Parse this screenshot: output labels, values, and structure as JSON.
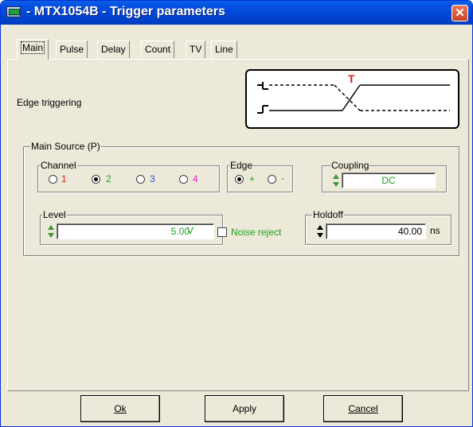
{
  "window": {
    "title": " - MTX1054B - Trigger parameters",
    "close_label": "✕"
  },
  "tabs": [
    {
      "label": "Main",
      "active": true
    },
    {
      "label": "Pulse"
    },
    {
      "label": "Delay"
    },
    {
      "label": "Count"
    },
    {
      "label": "TV"
    },
    {
      "label": "Line"
    }
  ],
  "main": {
    "mode_label": "Edge triggering",
    "diagram": {
      "marker": "T"
    },
    "source": {
      "title": "Main Source (P)",
      "channel": {
        "title": "Channel",
        "options": [
          {
            "label": "1",
            "color": "#e02020",
            "checked": false
          },
          {
            "label": "2",
            "color": "#20a020",
            "checked": true
          },
          {
            "label": "3",
            "color": "#3050e0",
            "checked": false
          },
          {
            "label": "4",
            "color": "#e020c0",
            "checked": false
          }
        ]
      },
      "edge": {
        "title": "Edge",
        "options": [
          {
            "label": "+",
            "checked": true
          },
          {
            "label": "-",
            "checked": false
          }
        ]
      },
      "coupling": {
        "title": "Coupling",
        "value": "DC"
      },
      "level": {
        "title": "Level",
        "value": "5.00",
        "unit": "V"
      },
      "noise_reject": {
        "label": "Noise reject",
        "checked": false
      },
      "holdoff": {
        "title": "Holdoff",
        "value": "40.00",
        "unit": "ns"
      }
    }
  },
  "buttons": {
    "ok": "Ok",
    "apply": "Apply",
    "cancel": "Cancel"
  }
}
